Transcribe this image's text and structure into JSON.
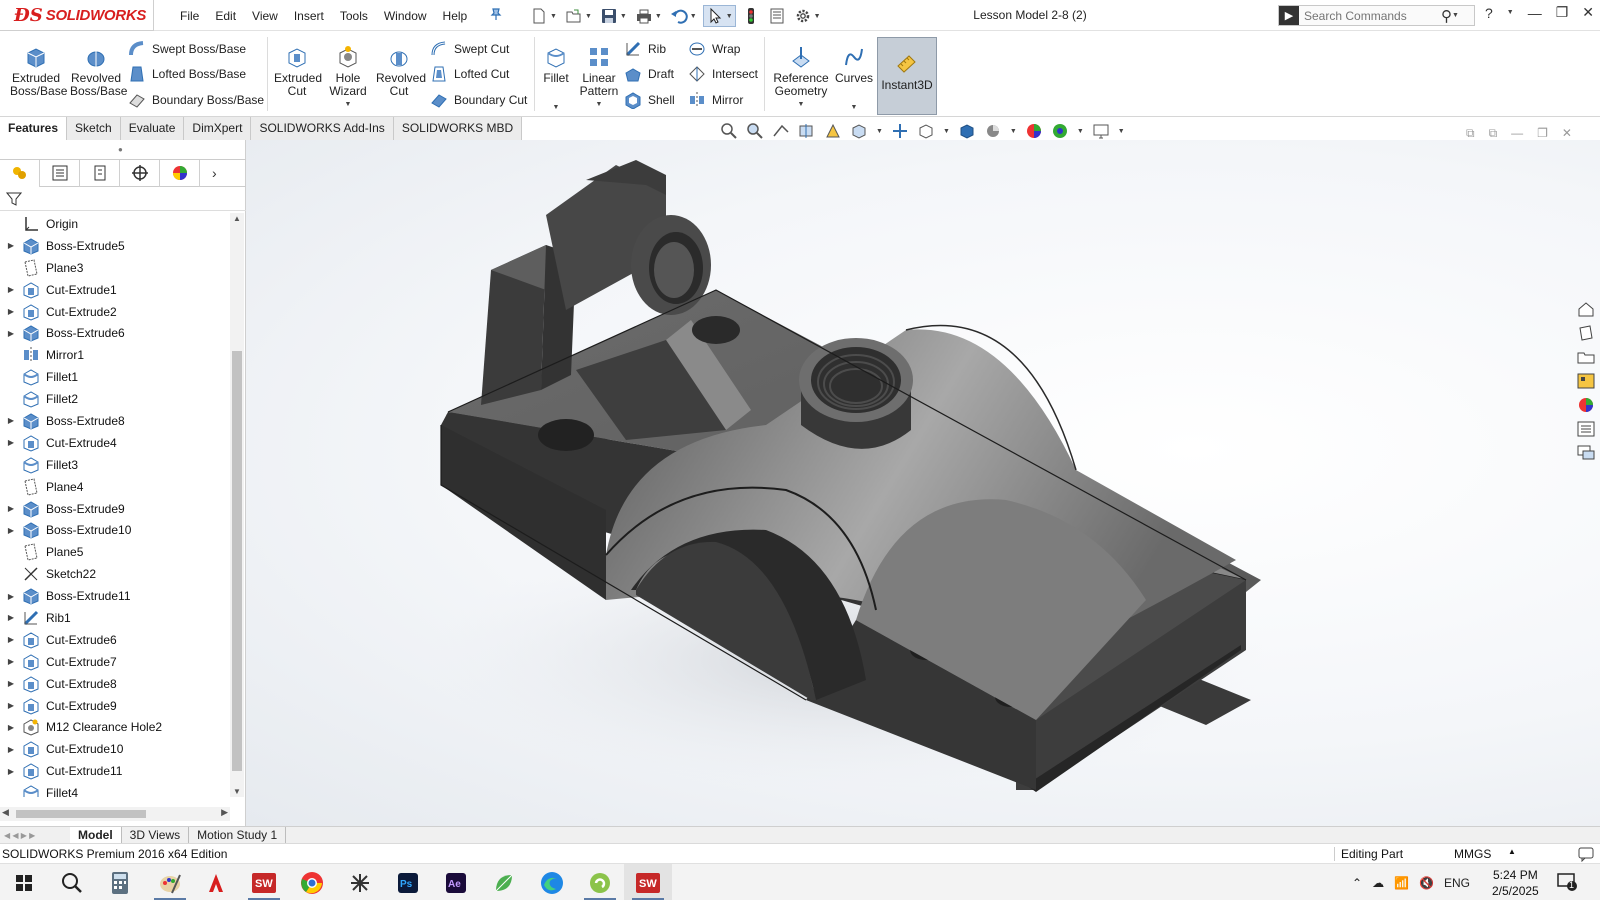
{
  "app": {
    "brand": "SOLIDWORKS",
    "document_title": "Lesson Model 2-8 (2)"
  },
  "menu": [
    "File",
    "Edit",
    "View",
    "Insert",
    "Tools",
    "Window",
    "Help"
  ],
  "search": {
    "placeholder": "Search Commands"
  },
  "commands": {
    "extruded_boss": "Extruded Boss/Base",
    "revolved_boss": "Revolved Boss/Base",
    "swept_boss": "Swept Boss/Base",
    "lofted_boss": "Lofted Boss/Base",
    "boundary_boss": "Boundary Boss/Base",
    "extruded_cut": "Extruded Cut",
    "hole_wizard": "Hole Wizard",
    "revolved_cut": "Revolved Cut",
    "swept_cut": "Swept Cut",
    "lofted_cut": "Lofted Cut",
    "boundary_cut": "Boundary Cut",
    "fillet": "Fillet",
    "linear_pattern": "Linear Pattern",
    "rib": "Rib",
    "draft": "Draft",
    "shell": "Shell",
    "wrap": "Wrap",
    "intersect": "Intersect",
    "mirror": "Mirror",
    "reference_geometry": "Reference Geometry",
    "curves": "Curves",
    "instant3d": "Instant3D"
  },
  "command_tabs": [
    {
      "label": "Features",
      "active": true
    },
    {
      "label": "Sketch",
      "active": false
    },
    {
      "label": "Evaluate",
      "active": false
    },
    {
      "label": "DimXpert",
      "active": false
    },
    {
      "label": "SOLIDWORKS Add-Ins",
      "active": false
    },
    {
      "label": "SOLIDWORKS MBD",
      "active": false
    }
  ],
  "tree": [
    {
      "label": "Origin",
      "icon": "origin-icon",
      "expandable": false
    },
    {
      "label": "Boss-Extrude5",
      "icon": "boss-extrude-icon",
      "expandable": true
    },
    {
      "label": "Plane3",
      "icon": "plane-icon",
      "expandable": false
    },
    {
      "label": "Cut-Extrude1",
      "icon": "cut-extrude-icon",
      "expandable": true
    },
    {
      "label": "Cut-Extrude2",
      "icon": "cut-extrude-icon",
      "expandable": true
    },
    {
      "label": "Boss-Extrude6",
      "icon": "boss-extrude-icon",
      "expandable": true
    },
    {
      "label": "Mirror1",
      "icon": "mirror-icon",
      "expandable": false
    },
    {
      "label": "Fillet1",
      "icon": "fillet-icon",
      "expandable": false
    },
    {
      "label": "Fillet2",
      "icon": "fillet-icon",
      "expandable": false
    },
    {
      "label": "Boss-Extrude8",
      "icon": "boss-extrude-icon",
      "expandable": true
    },
    {
      "label": "Cut-Extrude4",
      "icon": "cut-extrude-icon",
      "expandable": true
    },
    {
      "label": "Fillet3",
      "icon": "fillet-icon",
      "expandable": false
    },
    {
      "label": "Plane4",
      "icon": "plane-icon",
      "expandable": false
    },
    {
      "label": "Boss-Extrude9",
      "icon": "boss-extrude-icon",
      "expandable": true
    },
    {
      "label": "Boss-Extrude10",
      "icon": "boss-extrude-icon",
      "expandable": true
    },
    {
      "label": "Plane5",
      "icon": "plane-icon",
      "expandable": false
    },
    {
      "label": "Sketch22",
      "icon": "sketch-icon",
      "expandable": false
    },
    {
      "label": "Boss-Extrude11",
      "icon": "boss-extrude-icon",
      "expandable": true
    },
    {
      "label": "Rib1",
      "icon": "rib-icon",
      "expandable": true
    },
    {
      "label": "Cut-Extrude6",
      "icon": "cut-extrude-icon",
      "expandable": true
    },
    {
      "label": "Cut-Extrude7",
      "icon": "cut-extrude-icon",
      "expandable": true
    },
    {
      "label": "Cut-Extrude8",
      "icon": "cut-extrude-icon",
      "expandable": true
    },
    {
      "label": "Cut-Extrude9",
      "icon": "cut-extrude-icon",
      "expandable": true
    },
    {
      "label": "M12 Clearance Hole2",
      "icon": "hole-wizard-icon",
      "expandable": true
    },
    {
      "label": "Cut-Extrude10",
      "icon": "cut-extrude-icon",
      "expandable": true
    },
    {
      "label": "Cut-Extrude11",
      "icon": "cut-extrude-icon",
      "expandable": true
    },
    {
      "label": "Fillet4",
      "icon": "fillet-icon",
      "expandable": false
    }
  ],
  "bottom_tabs": [
    {
      "label": "Model",
      "active": true
    },
    {
      "label": "3D Views",
      "active": false
    },
    {
      "label": "Motion Study 1",
      "active": false
    }
  ],
  "status": {
    "edition": "SOLIDWORKS Premium 2016 x64 Edition",
    "mode": "Editing Part",
    "units": "MMGS"
  },
  "taskbar": {
    "language": "ENG",
    "time": "5:24 PM",
    "date": "2/5/2025",
    "notification_count": "1"
  },
  "colors": {
    "brand_red": "#d81e1e",
    "part_dark": "#3a3a3a",
    "part_light": "#9a9a9a",
    "feature_blue": "#2f6fb3"
  }
}
